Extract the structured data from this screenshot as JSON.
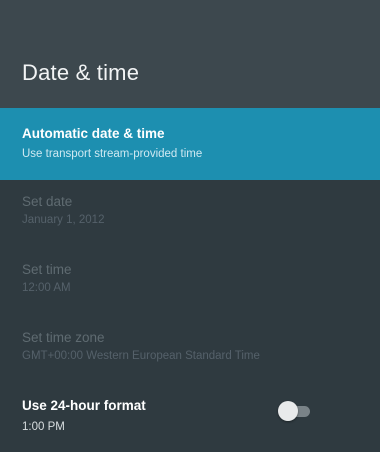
{
  "header": {
    "title": "Date & time"
  },
  "settings": [
    {
      "title": "Automatic date & time",
      "subtitle": "Use transport stream-provided time",
      "state": "selected"
    },
    {
      "title": "Set date",
      "subtitle": "January 1, 2012",
      "state": "disabled"
    },
    {
      "title": "Set time",
      "subtitle": "12:00 AM",
      "state": "disabled"
    },
    {
      "title": "Set time zone",
      "subtitle": "GMT+00:00 Western European Standard Time",
      "state": "disabled"
    },
    {
      "title": "Use 24-hour format",
      "subtitle": "1:00 PM",
      "state": "enabled",
      "toggle_on": false
    }
  ],
  "colors": {
    "background": "#2f3a40",
    "header": "#3d484e",
    "selected": "#1d8fb0"
  },
  "icons": {
    "toggle": "toggle-switch-off"
  }
}
